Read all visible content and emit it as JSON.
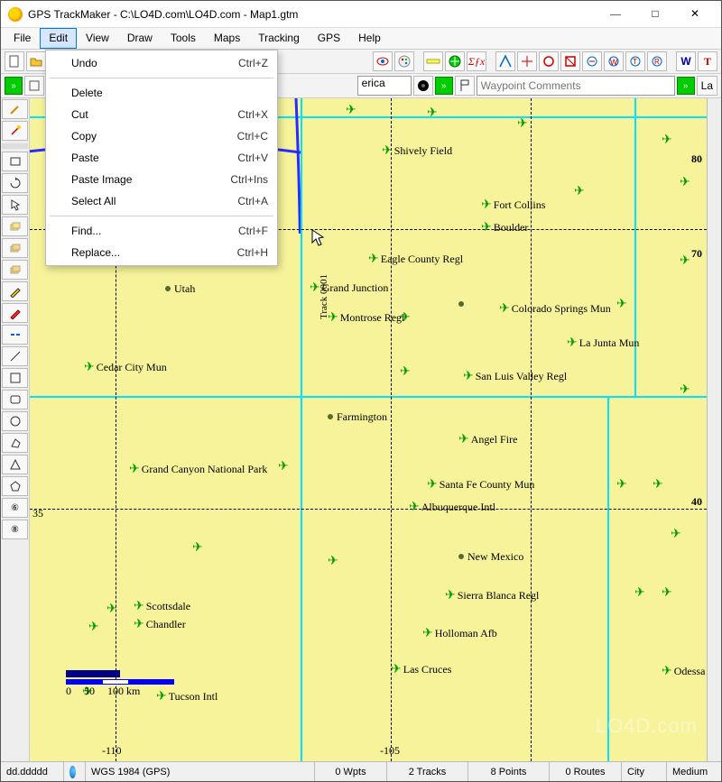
{
  "title": "GPS TrackMaker - C:\\LO4D.com\\LO4D.com - Map1.gtm",
  "menus": [
    "File",
    "Edit",
    "View",
    "Draw",
    "Tools",
    "Maps",
    "Tracking",
    "GPS",
    "Help"
  ],
  "active_menu_index": 1,
  "edit_menu": [
    {
      "type": "item",
      "label": "Undo",
      "shortcut": "Ctrl+Z"
    },
    {
      "type": "sep"
    },
    {
      "type": "item",
      "label": "Delete",
      "shortcut": ""
    },
    {
      "type": "item",
      "label": "Cut",
      "shortcut": "Ctrl+X"
    },
    {
      "type": "item",
      "label": "Copy",
      "shortcut": "Ctrl+C"
    },
    {
      "type": "item",
      "label": "Paste",
      "shortcut": "Ctrl+V"
    },
    {
      "type": "item",
      "label": "Paste Image",
      "shortcut": "Ctrl+Ins"
    },
    {
      "type": "item",
      "label": "Select All",
      "shortcut": "Ctrl+A"
    },
    {
      "type": "sep"
    },
    {
      "type": "item",
      "label": "Find...",
      "shortcut": "Ctrl+F"
    },
    {
      "type": "item",
      "label": "Replace...",
      "shortcut": "Ctrl+H"
    }
  ],
  "toolbar2": {
    "region_tail": "erica",
    "waypoint_placeholder": "Waypoint Comments",
    "right_label": "La"
  },
  "map_labels": {
    "shively": "Shively Field",
    "fortcollins": "Fort Collins",
    "boulder": "Boulder",
    "eagle": "Eagle County Regl",
    "grandjct": "Grand Junction",
    "montrose": "Montrose Regl",
    "cosprings": "Colorado Springs Mun",
    "lajunta": "La Junta Mun",
    "sanluis": "San Luis Valley Regl",
    "cedar": "Cedar City Mun",
    "utah": "Utah",
    "farmington": "Farmington",
    "angelfire": "Angel Fire",
    "grandcanyon": "Grand Canyon National Park",
    "santafe": "Santa Fe County Mun",
    "albuquerque": "Albuquerque Intl",
    "newmexico": "New Mexico",
    "sierra": "Sierra Blanca Regl",
    "holloman": "Holloman Afb",
    "lascruces": "Las Cruces",
    "scottsdale": "Scottsdale",
    "chandler": "Chandler",
    "tucson": "Tucson Intl",
    "odessa": "Odessa",
    "track": "Track 0001",
    "lat80": "80",
    "lat70": "70",
    "lat40": "40",
    "lat35": "35",
    "lon110": "-110",
    "lon105": "-105"
  },
  "scale": {
    "t0": "0",
    "t1": "50",
    "t2": "100 km"
  },
  "status": {
    "coord": "dd.ddddd",
    "datum": "WGS 1984 (GPS)",
    "wpts": "0 Wpts",
    "tracks": "2 Tracks",
    "points": "8 Points",
    "routes": "0 Routes",
    "city": "City",
    "zoom": "Medium"
  },
  "watermark": "LO4D.com"
}
